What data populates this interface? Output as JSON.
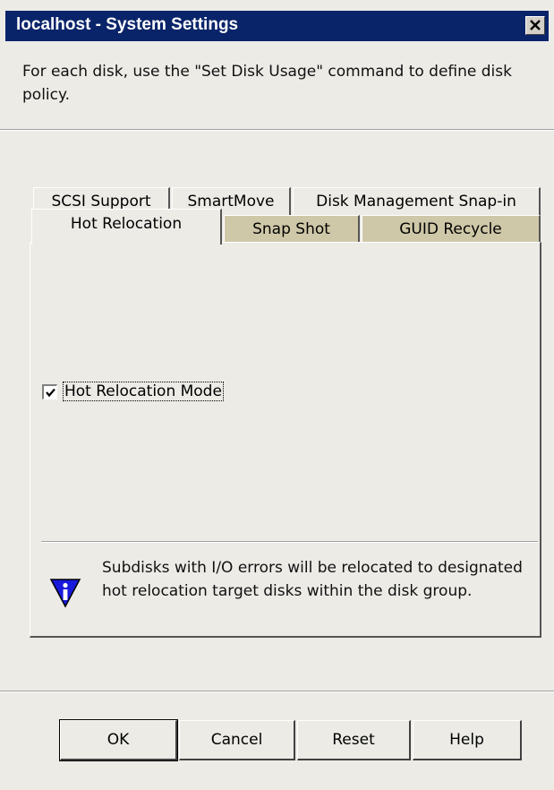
{
  "window": {
    "title": "localhost - System Settings",
    "description": "For each disk, use the \"Set Disk Usage\" command to define disk policy."
  },
  "tabs": {
    "row_back": [
      "SCSI Support",
      "SmartMove",
      "Disk Management Snap-in"
    ],
    "row_front": [
      "Hot Relocation",
      "Snap Shot",
      "GUID Recycle"
    ],
    "active": "Hot Relocation"
  },
  "panel": {
    "checkbox_label": "Hot Relocation Mode",
    "checkbox_checked": true,
    "info_text": "Subdisks with I/O errors will be relocated to designated hot relocation target disks within the disk group."
  },
  "buttons": {
    "ok": "OK",
    "cancel": "Cancel",
    "reset": "Reset",
    "help": "Help"
  },
  "colors": {
    "titlebar": "#0a246a",
    "dialog_bg": "#ecebe6",
    "inactive_tab": "#cfc8a8",
    "info_icon": "#1a1adc"
  }
}
